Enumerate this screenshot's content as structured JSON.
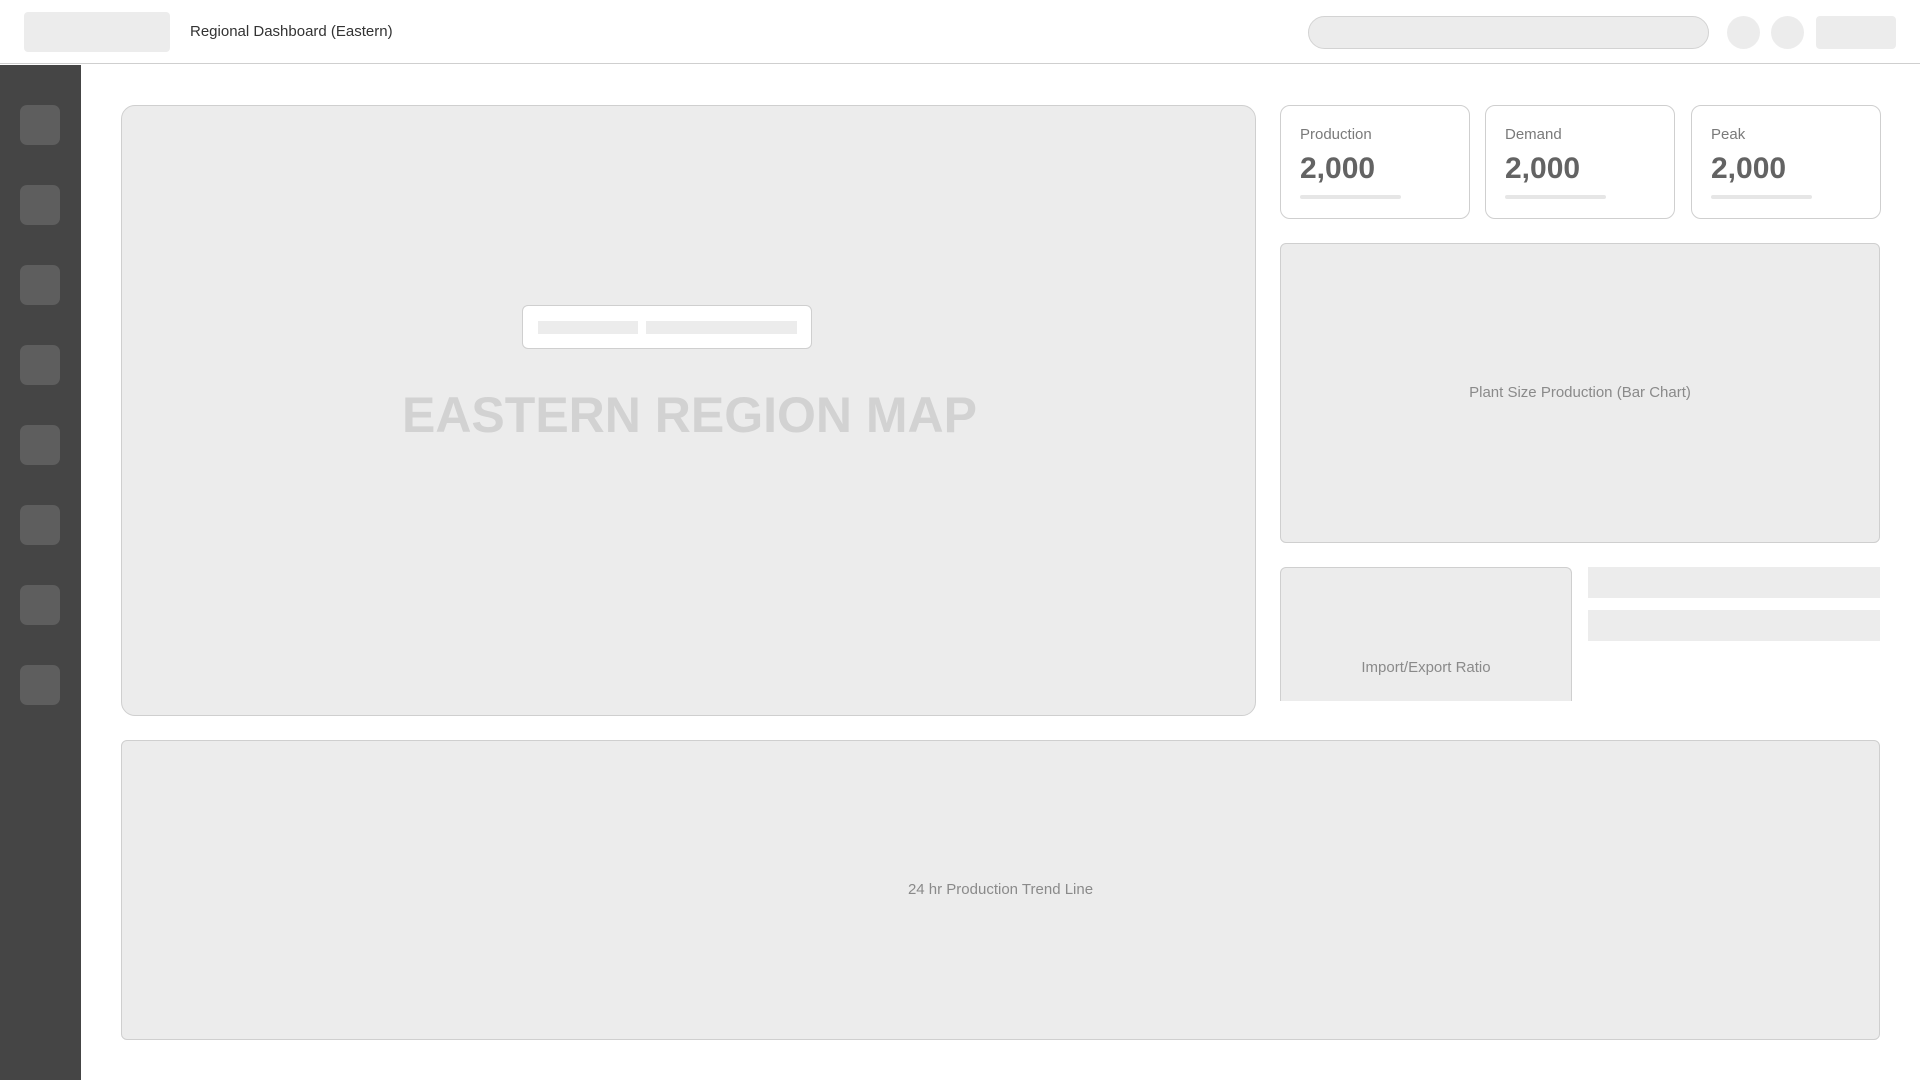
{
  "header": {
    "title": "Regional Dashboard (Eastern)"
  },
  "sidebar": {
    "items": [
      {
        "icon": "nav-icon-1"
      },
      {
        "icon": "nav-icon-2"
      },
      {
        "icon": "nav-icon-3"
      },
      {
        "icon": "nav-icon-4"
      },
      {
        "icon": "nav-icon-5"
      },
      {
        "icon": "nav-icon-6"
      },
      {
        "icon": "nav-icon-7"
      },
      {
        "icon": "nav-icon-8"
      }
    ]
  },
  "map": {
    "label": "EASTERN REGION MAP"
  },
  "stats": [
    {
      "label": "Production",
      "value": "2,000"
    },
    {
      "label": "Demand",
      "value": "2,000"
    },
    {
      "label": "Peak",
      "value": "2,000"
    }
  ],
  "panels": {
    "bar_chart": "Plant Size Production (Bar Chart)",
    "ratio": "Import/Export Ratio",
    "trend": "24 hr Production Trend Line"
  },
  "colors": {
    "sidebar": "#454545",
    "placeholder": "#ececec",
    "border": "#cfcfcf"
  }
}
